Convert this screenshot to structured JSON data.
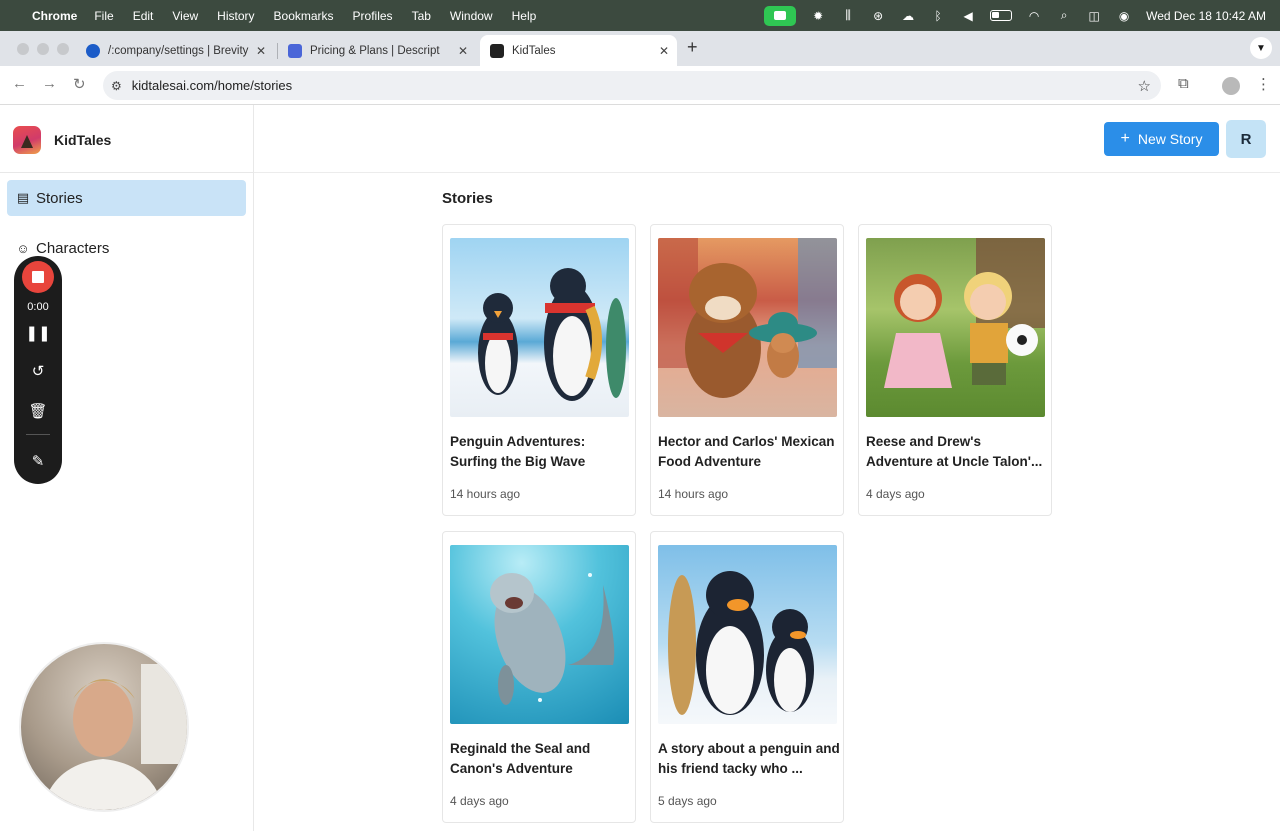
{
  "menubar": {
    "app": "Chrome",
    "items": [
      "File",
      "Edit",
      "View",
      "History",
      "Bookmarks",
      "Profiles",
      "Tab",
      "Window",
      "Help"
    ],
    "clock": "Wed Dec 18  10:42 AM"
  },
  "browser": {
    "tabs": [
      {
        "title": "/:company/settings | Brevity",
        "active": false
      },
      {
        "title": "Pricing & Plans | Descript",
        "active": false
      },
      {
        "title": "KidTales",
        "active": true
      }
    ],
    "url": "kidtalesai.com/home/stories"
  },
  "app": {
    "brand": "KidTales",
    "nav": [
      {
        "label": "Stories",
        "icon": "stories-icon",
        "active": true
      },
      {
        "label": "Characters",
        "icon": "characters-icon",
        "active": false
      }
    ],
    "new_story_label": "New Story",
    "avatar_initial": "R",
    "section_title": "Stories"
  },
  "stories": [
    {
      "title": "Penguin Adventures: Surfing the Big Wave",
      "time": "14 hours ago",
      "image": "penguins-surfing-image"
    },
    {
      "title": "Hector and Carlos' Mexican Food Adventure",
      "time": "14 hours ago",
      "image": "bulldog-and-chihuahua-image"
    },
    {
      "title": "Reese and Drew's Adventure at Uncle Talon'...",
      "time": "4 days ago",
      "image": "kids-with-soccer-ball-image"
    },
    {
      "title": "Reginald the Seal and Canon's Adventure",
      "time": "4 days ago",
      "image": "seal-underwater-image"
    },
    {
      "title": "A story about a penguin and his friend tacky who ...",
      "time": "5 days ago",
      "image": "two-penguins-image"
    }
  ],
  "recorder": {
    "time": "0:00"
  },
  "colors": {
    "menubar": "#3c4a3f",
    "primary_button": "#2b8ee8",
    "nav_active": "#c9e3f7",
    "record": "#e8453c"
  }
}
